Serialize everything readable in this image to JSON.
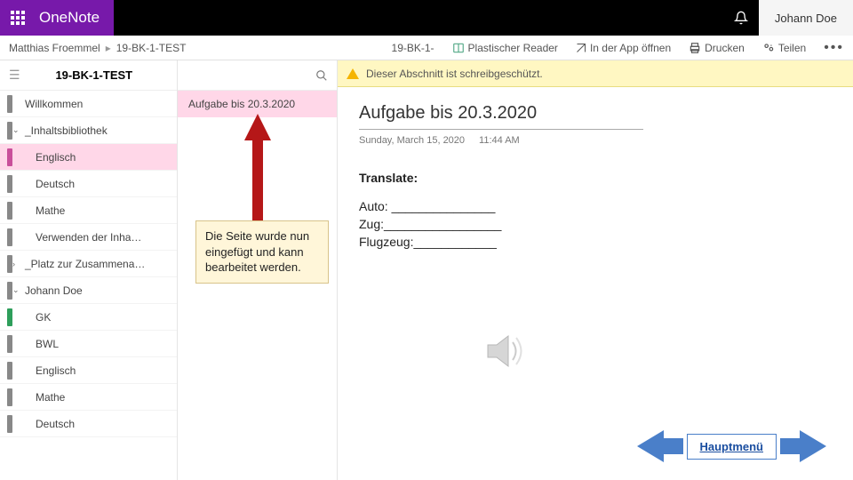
{
  "topbar": {
    "brand1": "One",
    "brand2": "Note",
    "user": "Johann Doe"
  },
  "crumbs": {
    "owner": "Matthias Froemmel",
    "notebook": "19-BK-1-TEST",
    "short": "19-BK-1-",
    "reader": "Plastischer Reader",
    "open_app": "In der App öffnen",
    "print": "Drucken",
    "share": "Teilen"
  },
  "sections": {
    "title": "19-BK-1-TEST",
    "items": [
      {
        "label": "Willkommen",
        "color": "#888",
        "lvl": 1
      },
      {
        "label": "_Inhaltsbibliothek",
        "color": "#888",
        "lvl": 1,
        "chev": "⌄"
      },
      {
        "label": "Englisch",
        "color": "#c94f9a",
        "lvl": 2,
        "sel": true
      },
      {
        "label": "Deutsch",
        "color": "#888",
        "lvl": 2
      },
      {
        "label": "Mathe",
        "color": "#888",
        "lvl": 2
      },
      {
        "label": "Verwenden der Inha…",
        "color": "#888",
        "lvl": 2
      },
      {
        "label": "_Platz zur Zusammena…",
        "color": "#888",
        "lvl": 1,
        "chev": "›"
      },
      {
        "label": "Johann Doe",
        "color": "#888",
        "lvl": 1,
        "chev": "⌄"
      },
      {
        "label": "GK",
        "color": "#2e9e5b",
        "lvl": 2
      },
      {
        "label": "BWL",
        "color": "#888",
        "lvl": 2
      },
      {
        "label": "Englisch",
        "color": "#888",
        "lvl": 2
      },
      {
        "label": "Mathe",
        "color": "#888",
        "lvl": 2
      },
      {
        "label": "Deutsch",
        "color": "#888",
        "lvl": 2
      }
    ]
  },
  "pages": {
    "items": [
      {
        "label": "Aufgabe bis 20.3.2020",
        "sel": true
      }
    ]
  },
  "annotation": "Die Seite wurde nun eingefügt und kann bearbeitet werden.",
  "warning": "Dieser Abschnitt ist schreibgeschützt.",
  "page": {
    "title": "Aufgabe bis 20.3.2020",
    "date": "Sunday, March 15, 2020",
    "time": "11:44 AM",
    "heading": "Translate:",
    "l1": "Auto: _______________",
    "l2": "Zug:_________________",
    "l3": "Flugzeug:____________"
  },
  "nav": {
    "label": "Hauptmenü"
  }
}
